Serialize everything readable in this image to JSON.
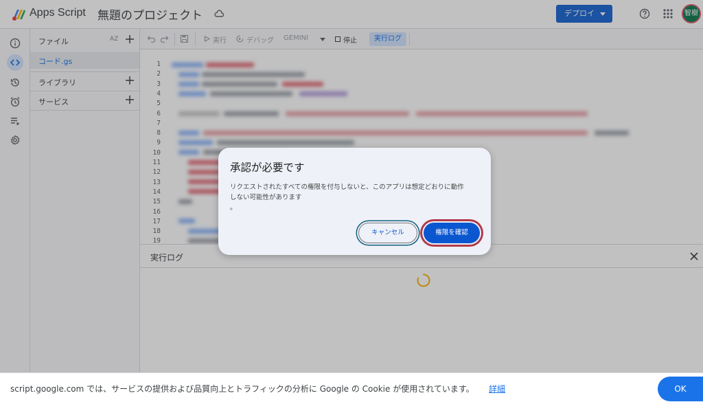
{
  "header": {
    "app_name": "Apps Script",
    "project_title": "無題のプロジェクト",
    "deploy_label": "デプロイ",
    "avatar_text": "智樹"
  },
  "rail": {
    "icons": [
      "info-icon",
      "code-icon",
      "history-icon",
      "alarm-icon",
      "executions-icon",
      "settings-icon"
    ],
    "active": "code-icon"
  },
  "files_panel": {
    "files_label": "ファイル",
    "sort_label": "AZ",
    "file_name": "コード.gs",
    "libraries_label": "ライブラリ",
    "services_label": "サービス"
  },
  "toolbar": {
    "run_label": "実行",
    "debug_label": "デバッグ",
    "function_label": "GEMINI",
    "stop_label": "停止",
    "log_label": "実行ログ"
  },
  "editor": {
    "line_numbers": [
      "1",
      "2",
      "3",
      "4",
      "5",
      "6",
      "7",
      "8",
      "9",
      "10",
      "11",
      "12",
      "13",
      "14",
      "15",
      "16",
      "17",
      "18",
      "19"
    ]
  },
  "log_panel": {
    "title": "実行ログ"
  },
  "dialog": {
    "title": "承認が必要です",
    "body_line1": "リクエストされたすべての権限を付与しないと、このアプリは想定どおりに動作",
    "body_line2": "しない可能性があります",
    "body_line3": "。",
    "cancel_label": "キャンセル",
    "confirm_label": "権限を確認"
  },
  "cookie_bar": {
    "text": "script.google.com では、サービスの提供および品質向上とトラフィックの分析に Google の Cookie が使用されています。",
    "link_label": "詳細",
    "ok_label": "OK"
  },
  "colors": {
    "primary": "#1a73e8",
    "confirm_button": "#0b57d0",
    "cancel_highlight": "#0f5f82",
    "confirm_highlight": "#b23a48"
  }
}
